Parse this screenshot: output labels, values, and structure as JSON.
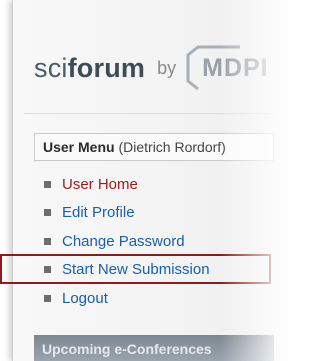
{
  "brand": {
    "sci": "sci",
    "forum": "forum",
    "by": "by",
    "publisher": "MDPI"
  },
  "user_menu": {
    "title": "User Menu",
    "user": "(Dietrich Rordorf)",
    "items": [
      {
        "label": "User Home"
      },
      {
        "label": "Edit Profile"
      },
      {
        "label": "Change Password"
      },
      {
        "label": "Start New Submission"
      },
      {
        "label": "Logout"
      }
    ]
  },
  "upcoming": {
    "title": "Upcoming e-Conferences"
  },
  "colors": {
    "active_item": "#9e1b1b",
    "link": "#1b5fa5",
    "highlight_border": "#8b1c1c"
  }
}
